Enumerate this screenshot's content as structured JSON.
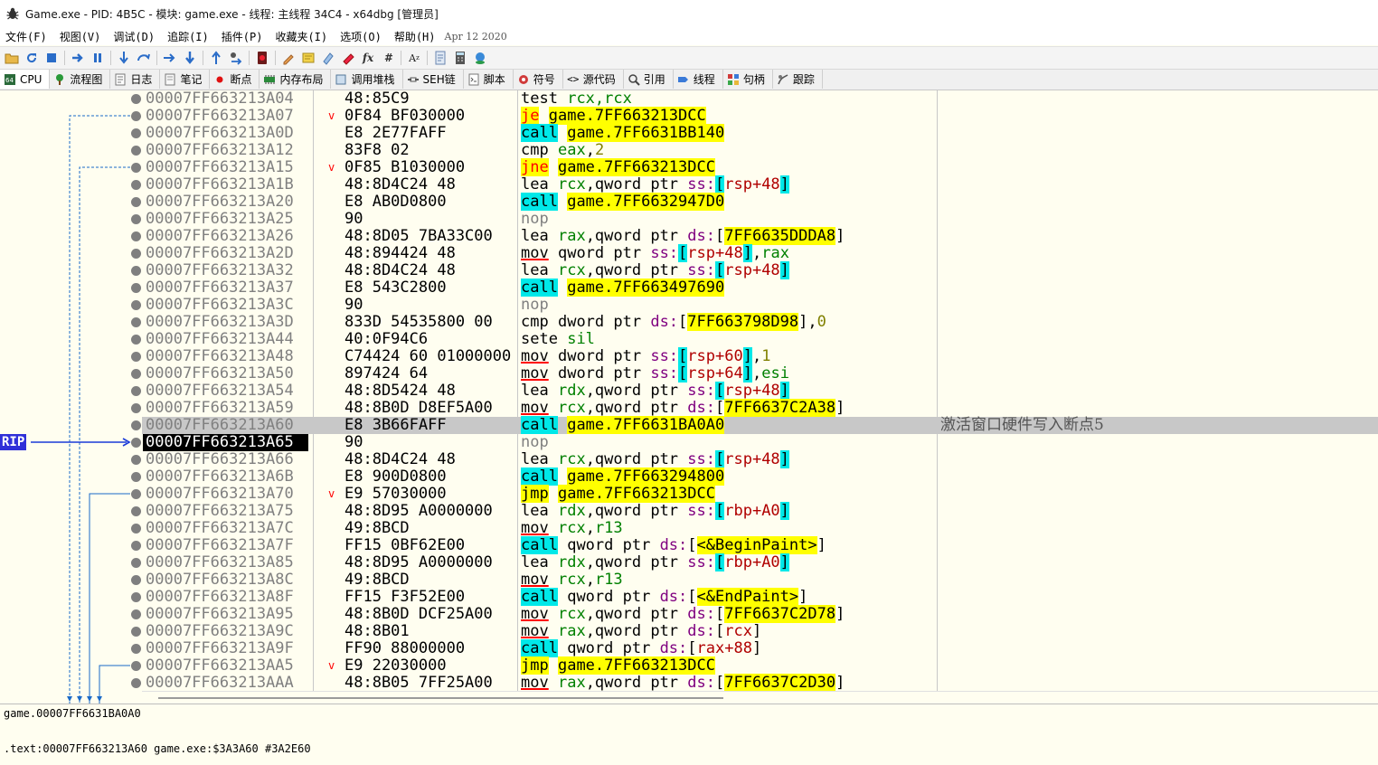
{
  "window": {
    "title": "Game.exe - PID: 4B5C - 模块: game.exe - 线程: 主线程 34C4 - x64dbg [管理员]"
  },
  "menu": {
    "items": [
      "文件(F)",
      "视图(V)",
      "调试(D)",
      "追踪(I)",
      "插件(P)",
      "收藏夹(I)",
      "选项(O)",
      "帮助(H)"
    ],
    "date": "Apr 12 2020"
  },
  "toolbar": {
    "icons": [
      "open-icon",
      "restart-icon",
      "stop-icon",
      "run-icon",
      "pause-icon",
      "step-into-icon",
      "step-over-icon",
      "trace-into-icon",
      "trace-over-icon",
      "execute-till-return-icon",
      "run-to-user-code-icon",
      "breakpoint-icon",
      "comment-icon",
      "label-icon",
      "bookmark-icon",
      "function-icon",
      "fx-icon",
      "hash-icon",
      "font-icon",
      "patch-icon",
      "calculator-icon",
      "help-icon"
    ]
  },
  "tabs": [
    {
      "label": "CPU",
      "icon": "cpu-icon",
      "active": true
    },
    {
      "label": "流程图",
      "icon": "graph-icon"
    },
    {
      "label": "日志",
      "icon": "log-icon"
    },
    {
      "label": "笔记",
      "icon": "notes-icon"
    },
    {
      "label": "断点",
      "icon": "breakpoint-dot-icon"
    },
    {
      "label": "内存布局",
      "icon": "memory-map-icon"
    },
    {
      "label": "调用堆栈",
      "icon": "callstack-icon"
    },
    {
      "label": "SEH链",
      "icon": "seh-icon"
    },
    {
      "label": "脚本",
      "icon": "script-icon"
    },
    {
      "label": "符号",
      "icon": "symbols-icon"
    },
    {
      "label": "源代码",
      "icon": "source-icon"
    },
    {
      "label": "引用",
      "icon": "references-icon"
    },
    {
      "label": "线程",
      "icon": "threads-icon"
    },
    {
      "label": "句柄",
      "icon": "handles-icon"
    },
    {
      "label": "跟踪",
      "icon": "trace-icon"
    }
  ],
  "disasm": {
    "rip_label": "RIP",
    "rows": [
      {
        "addr": "00007FF663213A04",
        "bytes": "48:85C9",
        "jmark": "",
        "type": "plain",
        "mn": "test",
        "ops": [
          [
            "rcx,rcx",
            "reg"
          ]
        ],
        "cmt": ""
      },
      {
        "addr": "00007FF663213A07",
        "bytes": "0F84 BF030000",
        "jmark": "v",
        "type": "jcc",
        "mn": "je",
        "ops": [
          [
            "game.7FF663213DCC",
            "tgt"
          ]
        ],
        "cmt": ""
      },
      {
        "addr": "00007FF663213A0D",
        "bytes": "E8 2E77FAFF",
        "jmark": "",
        "type": "call",
        "mn": "call",
        "ops": [
          [
            "game.7FF6631BB140",
            "tgt"
          ]
        ],
        "cmt": ""
      },
      {
        "addr": "00007FF663213A12",
        "bytes": "83F8 02",
        "jmark": "",
        "type": "plain",
        "mn": "cmp",
        "ops": [
          [
            "eax",
            "reg"
          ],
          [
            ",",
            ""
          ],
          [
            "2",
            "num"
          ]
        ],
        "cmt": ""
      },
      {
        "addr": "00007FF663213A15",
        "bytes": "0F85 B1030000",
        "jmark": "v",
        "type": "jcc",
        "mn": "jne",
        "ops": [
          [
            "game.7FF663213DCC",
            "tgt"
          ]
        ],
        "cmt": ""
      },
      {
        "addr": "00007FF663213A1B",
        "bytes": "48:8D4C24 48",
        "jmark": "",
        "type": "plain",
        "mn": "lea",
        "ops": [
          [
            "rcx",
            "reg"
          ],
          [
            ",qword ptr ",
            ""
          ],
          [
            "ss:",
            "seg"
          ],
          [
            "[",
            "br"
          ],
          [
            "rsp+48",
            "mem"
          ],
          [
            "]",
            "br"
          ]
        ],
        "cmt": ""
      },
      {
        "addr": "00007FF663213A20",
        "bytes": "E8 AB0D0800",
        "jmark": "",
        "type": "call",
        "mn": "call",
        "ops": [
          [
            "game.7FF6632947D0",
            "tgt"
          ]
        ],
        "cmt": ""
      },
      {
        "addr": "00007FF663213A25",
        "bytes": "90",
        "jmark": "",
        "type": "nop",
        "mn": "nop",
        "ops": [],
        "cmt": ""
      },
      {
        "addr": "00007FF663213A26",
        "bytes": "48:8D05 7BA33C00",
        "jmark": "",
        "type": "plain",
        "mn": "lea",
        "ops": [
          [
            "rax",
            "reg"
          ],
          [
            ",qword ptr ",
            ""
          ],
          [
            "ds:",
            "seg"
          ],
          [
            "[",
            ""
          ],
          [
            "7FF6635DDDA8",
            "tgt"
          ],
          [
            "]",
            ""
          ]
        ],
        "cmt": ""
      },
      {
        "addr": "00007FF663213A2D",
        "bytes": "48:894424 48",
        "jmark": "",
        "type": "mov",
        "mn": "mov",
        "ops": [
          [
            "qword ptr ",
            ""
          ],
          [
            "ss:",
            "seg"
          ],
          [
            "[",
            "br"
          ],
          [
            "rsp+48",
            "mem"
          ],
          [
            "]",
            "br"
          ],
          [
            ",",
            ""
          ],
          [
            "rax",
            "reg"
          ]
        ],
        "cmt": ""
      },
      {
        "addr": "00007FF663213A32",
        "bytes": "48:8D4C24 48",
        "jmark": "",
        "type": "plain",
        "mn": "lea",
        "ops": [
          [
            "rcx",
            "reg"
          ],
          [
            ",qword ptr ",
            ""
          ],
          [
            "ss:",
            "seg"
          ],
          [
            "[",
            "br"
          ],
          [
            "rsp+48",
            "mem"
          ],
          [
            "]",
            "br"
          ]
        ],
        "cmt": ""
      },
      {
        "addr": "00007FF663213A37",
        "bytes": "E8 543C2800",
        "jmark": "",
        "type": "call",
        "mn": "call",
        "ops": [
          [
            "game.7FF663497690",
            "tgt"
          ]
        ],
        "cmt": ""
      },
      {
        "addr": "00007FF663213A3C",
        "bytes": "90",
        "jmark": "",
        "type": "nop",
        "mn": "nop",
        "ops": [],
        "cmt": ""
      },
      {
        "addr": "00007FF663213A3D",
        "bytes": "833D 54535800 00",
        "jmark": "",
        "type": "plain",
        "mn": "cmp",
        "ops": [
          [
            "dword ptr ",
            ""
          ],
          [
            "ds:",
            "seg"
          ],
          [
            "[",
            ""
          ],
          [
            "7FF663798D98",
            "tgt"
          ],
          [
            "],",
            ""
          ],
          [
            "0",
            "num"
          ]
        ],
        "cmt": ""
      },
      {
        "addr": "00007FF663213A44",
        "bytes": "40:0F94C6",
        "jmark": "",
        "type": "plain",
        "mn": "sete",
        "ops": [
          [
            "sil",
            "reg"
          ]
        ],
        "cmt": ""
      },
      {
        "addr": "00007FF663213A48",
        "bytes": "C74424 60 01000000",
        "jmark": "",
        "type": "mov",
        "mn": "mov",
        "ops": [
          [
            "dword ptr ",
            ""
          ],
          [
            "ss:",
            "seg"
          ],
          [
            "[",
            "br"
          ],
          [
            "rsp+60",
            "mem"
          ],
          [
            "]",
            "br"
          ],
          [
            ",",
            ""
          ],
          [
            "1",
            "num"
          ]
        ],
        "cmt": ""
      },
      {
        "addr": "00007FF663213A50",
        "bytes": "897424 64",
        "jmark": "",
        "type": "mov",
        "mn": "mov",
        "ops": [
          [
            "dword ptr ",
            ""
          ],
          [
            "ss:",
            "seg"
          ],
          [
            "[",
            "br"
          ],
          [
            "rsp+64",
            "mem"
          ],
          [
            "]",
            "br"
          ],
          [
            ",",
            ""
          ],
          [
            "esi",
            "reg"
          ]
        ],
        "cmt": ""
      },
      {
        "addr": "00007FF663213A54",
        "bytes": "48:8D5424 48",
        "jmark": "",
        "type": "plain",
        "mn": "lea",
        "ops": [
          [
            "rdx",
            "reg"
          ],
          [
            ",qword ptr ",
            ""
          ],
          [
            "ss:",
            "seg"
          ],
          [
            "[",
            "br"
          ],
          [
            "rsp+48",
            "mem"
          ],
          [
            "]",
            "br"
          ]
        ],
        "cmt": ""
      },
      {
        "addr": "00007FF663213A59",
        "bytes": "48:8B0D D8EF5A00",
        "jmark": "",
        "type": "mov",
        "mn": "mov",
        "ops": [
          [
            "rcx",
            "reg"
          ],
          [
            ",qword ptr ",
            ""
          ],
          [
            "ds:",
            "seg"
          ],
          [
            "[",
            ""
          ],
          [
            "7FF6637C2A38",
            "tgt"
          ],
          [
            "]",
            ""
          ]
        ],
        "cmt": ""
      },
      {
        "addr": "00007FF663213A60",
        "bytes": "E8 3B66FAFF",
        "jmark": "",
        "type": "call",
        "mn": "call",
        "ops": [
          [
            "game.7FF6631BA0A0",
            "tgt"
          ]
        ],
        "cmt": "激活窗口硬件写入断点5",
        "sel": true
      },
      {
        "addr": "00007FF663213A65",
        "bytes": "90",
        "jmark": "",
        "type": "nop",
        "mn": "nop",
        "ops": [],
        "cmt": "",
        "rip": true
      },
      {
        "addr": "00007FF663213A66",
        "bytes": "48:8D4C24 48",
        "jmark": "",
        "type": "plain",
        "mn": "lea",
        "ops": [
          [
            "rcx",
            "reg"
          ],
          [
            ",qword ptr ",
            ""
          ],
          [
            "ss:",
            "seg"
          ],
          [
            "[",
            "br"
          ],
          [
            "rsp+48",
            "mem"
          ],
          [
            "]",
            "br"
          ]
        ],
        "cmt": ""
      },
      {
        "addr": "00007FF663213A6B",
        "bytes": "E8 900D0800",
        "jmark": "",
        "type": "call",
        "mn": "call",
        "ops": [
          [
            "game.7FF663294800",
            "tgt"
          ]
        ],
        "cmt": ""
      },
      {
        "addr": "00007FF663213A70",
        "bytes": "E9 57030000",
        "jmark": "v",
        "type": "jmp",
        "mn": "jmp",
        "ops": [
          [
            "game.7FF663213DCC",
            "tgt"
          ]
        ],
        "cmt": ""
      },
      {
        "addr": "00007FF663213A75",
        "bytes": "48:8D95 A0000000",
        "jmark": "",
        "type": "plain",
        "mn": "lea",
        "ops": [
          [
            "rdx",
            "reg"
          ],
          [
            ",qword ptr ",
            ""
          ],
          [
            "ss:",
            "seg"
          ],
          [
            "[",
            "br"
          ],
          [
            "rbp+A0",
            "mem"
          ],
          [
            "]",
            "br"
          ]
        ],
        "cmt": ""
      },
      {
        "addr": "00007FF663213A7C",
        "bytes": "49:8BCD",
        "jmark": "",
        "type": "mov",
        "mn": "mov",
        "ops": [
          [
            "rcx",
            "reg"
          ],
          [
            ",",
            ""
          ],
          [
            "r13",
            "reg"
          ]
        ],
        "cmt": ""
      },
      {
        "addr": "00007FF663213A7F",
        "bytes": "FF15 0BF62E00",
        "jmark": "",
        "type": "call",
        "mn": "call",
        "ops": [
          [
            "qword ptr ",
            ""
          ],
          [
            "ds:",
            "seg"
          ],
          [
            "[",
            ""
          ],
          [
            "<&BeginPaint>",
            "tgt"
          ],
          [
            "]",
            ""
          ]
        ],
        "cmt": ""
      },
      {
        "addr": "00007FF663213A85",
        "bytes": "48:8D95 A0000000",
        "jmark": "",
        "type": "plain",
        "mn": "lea",
        "ops": [
          [
            "rdx",
            "reg"
          ],
          [
            ",qword ptr ",
            ""
          ],
          [
            "ss:",
            "seg"
          ],
          [
            "[",
            "br"
          ],
          [
            "rbp+A0",
            "mem"
          ],
          [
            "]",
            "br"
          ]
        ],
        "cmt": ""
      },
      {
        "addr": "00007FF663213A8C",
        "bytes": "49:8BCD",
        "jmark": "",
        "type": "mov",
        "mn": "mov",
        "ops": [
          [
            "rcx",
            "reg"
          ],
          [
            ",",
            ""
          ],
          [
            "r13",
            "reg"
          ]
        ],
        "cmt": ""
      },
      {
        "addr": "00007FF663213A8F",
        "bytes": "FF15 F3F52E00",
        "jmark": "",
        "type": "call",
        "mn": "call",
        "ops": [
          [
            "qword ptr ",
            ""
          ],
          [
            "ds:",
            "seg"
          ],
          [
            "[",
            ""
          ],
          [
            "<&EndPaint>",
            "tgt"
          ],
          [
            "]",
            ""
          ]
        ],
        "cmt": ""
      },
      {
        "addr": "00007FF663213A95",
        "bytes": "48:8B0D DCF25A00",
        "jmark": "",
        "type": "mov",
        "mn": "mov",
        "ops": [
          [
            "rcx",
            "reg"
          ],
          [
            ",qword ptr ",
            ""
          ],
          [
            "ds:",
            "seg"
          ],
          [
            "[",
            ""
          ],
          [
            "7FF6637C2D78",
            "tgt"
          ],
          [
            "]",
            ""
          ]
        ],
        "cmt": ""
      },
      {
        "addr": "00007FF663213A9C",
        "bytes": "48:8B01",
        "jmark": "",
        "type": "mov",
        "mn": "mov",
        "ops": [
          [
            "rax",
            "reg"
          ],
          [
            ",qword ptr ",
            ""
          ],
          [
            "ds:",
            "seg"
          ],
          [
            "[",
            ""
          ],
          [
            "rcx",
            "mem"
          ],
          [
            "]",
            ""
          ]
        ],
        "cmt": ""
      },
      {
        "addr": "00007FF663213A9F",
        "bytes": "FF90 88000000",
        "jmark": "",
        "type": "call",
        "mn": "call",
        "ops": [
          [
            "qword ptr ",
            ""
          ],
          [
            "ds:",
            "seg"
          ],
          [
            "[",
            ""
          ],
          [
            "rax+88",
            "mem"
          ],
          [
            "]",
            ""
          ]
        ],
        "cmt": ""
      },
      {
        "addr": "00007FF663213AA5",
        "bytes": "E9 22030000",
        "jmark": "v",
        "type": "jmp",
        "mn": "jmp",
        "ops": [
          [
            "game.7FF663213DCC",
            "tgt"
          ]
        ],
        "cmt": ""
      },
      {
        "addr": "00007FF663213AAA",
        "bytes": "48:8B05 7FF25A00",
        "jmark": "",
        "type": "mov",
        "mn": "mov",
        "ops": [
          [
            "rax",
            "reg"
          ],
          [
            ",qword ptr ",
            ""
          ],
          [
            "ds:",
            "seg"
          ],
          [
            "[",
            ""
          ],
          [
            "7FF6637C2D30",
            "tgt"
          ],
          [
            "]",
            ""
          ]
        ],
        "cmt": ""
      }
    ]
  },
  "info": {
    "line1": "game.00007FF6631BA0A0",
    "line2": ".text:00007FF663213A60 game.exe:$3A3A60 #3A2E60"
  },
  "colors": {
    "call_bg": "#00e8e8",
    "jump_bg": "#ffff00",
    "jcc_fg": "#ff0000",
    "selected_row": "#c8c8c8",
    "rip_label_bg": "#3030d8",
    "background": "#fffef0"
  }
}
